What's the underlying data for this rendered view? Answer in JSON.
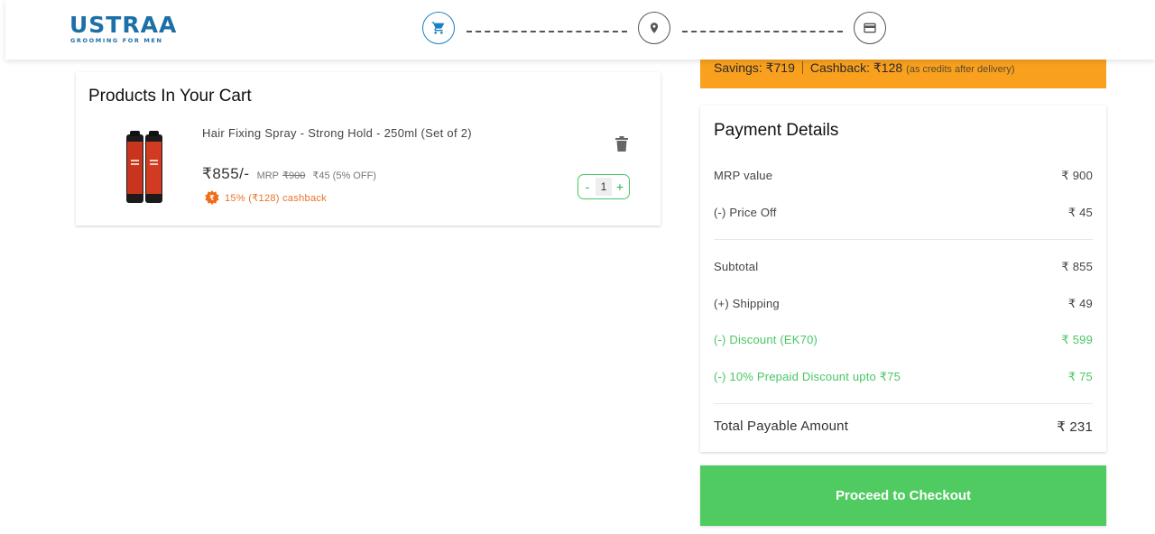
{
  "header": {
    "logo_main": "USTRAA",
    "logo_sub": "GROOMING FOR MEN",
    "steps": [
      "cart",
      "address",
      "payment"
    ]
  },
  "cart": {
    "title": "Products In Your Cart",
    "item": {
      "name": "Hair Fixing Spray - Strong Hold - 250ml (Set of 2)",
      "price": "₹855/-",
      "mrp_label": "MRP",
      "mrp_value": "₹900",
      "discount": "₹45 (5% OFF)",
      "cashback": "15% (₹128) cashback",
      "quantity": "1",
      "minus": "-",
      "plus": "+"
    }
  },
  "savings": {
    "savings_text": "Savings: ₹719",
    "cashback_text": "Cashback: ₹128",
    "note": "(as credits after delivery)"
  },
  "payment": {
    "title": "Payment Details",
    "rows": [
      {
        "label": "MRP value",
        "value": "₹ 900"
      },
      {
        "label": "(-) Price Off",
        "value": "₹ 45"
      },
      {
        "label": "Subtotal",
        "value": "₹ 855"
      },
      {
        "label": "(+) Shipping",
        "value": "₹ 49"
      },
      {
        "label": "(-) Discount (EK70)",
        "value": "₹ 599"
      },
      {
        "label": "(-) 10% Prepaid Discount upto ₹75",
        "value": "₹ 75"
      }
    ],
    "total_label": "Total Payable Amount",
    "total_value": "₹ 231"
  },
  "checkout_label": "Proceed to Checkout",
  "colors": {
    "brand": "#1d6fa8",
    "savings_bg": "#f9a11f",
    "green": "#48c764",
    "checkout_bg": "#4fcb62",
    "cashback": "#e8742a"
  }
}
